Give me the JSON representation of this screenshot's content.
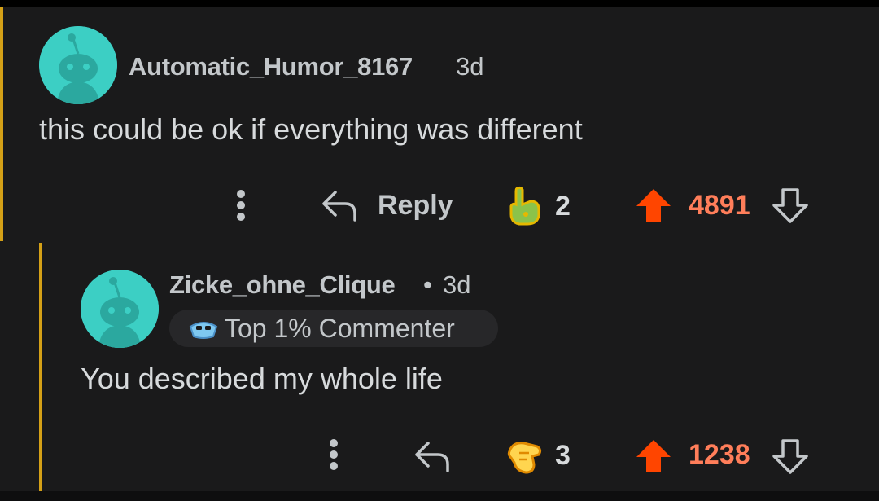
{
  "colors": {
    "background": "#1a1a1b",
    "thread_line": "#d4a017",
    "upvote": "#ff4500",
    "vote_count_active": "#ff7e5a",
    "avatar": "#3ccfc4"
  },
  "comments": [
    {
      "username": "Automatic_Humor_8167",
      "age": "3d",
      "body": "this could be ok if everything was different",
      "reply_label": "Reply",
      "award_icon": "pointing-hand-award-icon",
      "award_count": "2",
      "vote_count": "4891"
    },
    {
      "username": "Zicke_ohne_Clique",
      "separator": "•",
      "age": "3d",
      "flair": "Top 1% Commenter",
      "flair_icon": "commenter-badge-icon",
      "body": "You described my whole life",
      "award_icon": "shrug-hand-award-icon",
      "award_count": "3",
      "vote_count": "1238"
    }
  ]
}
